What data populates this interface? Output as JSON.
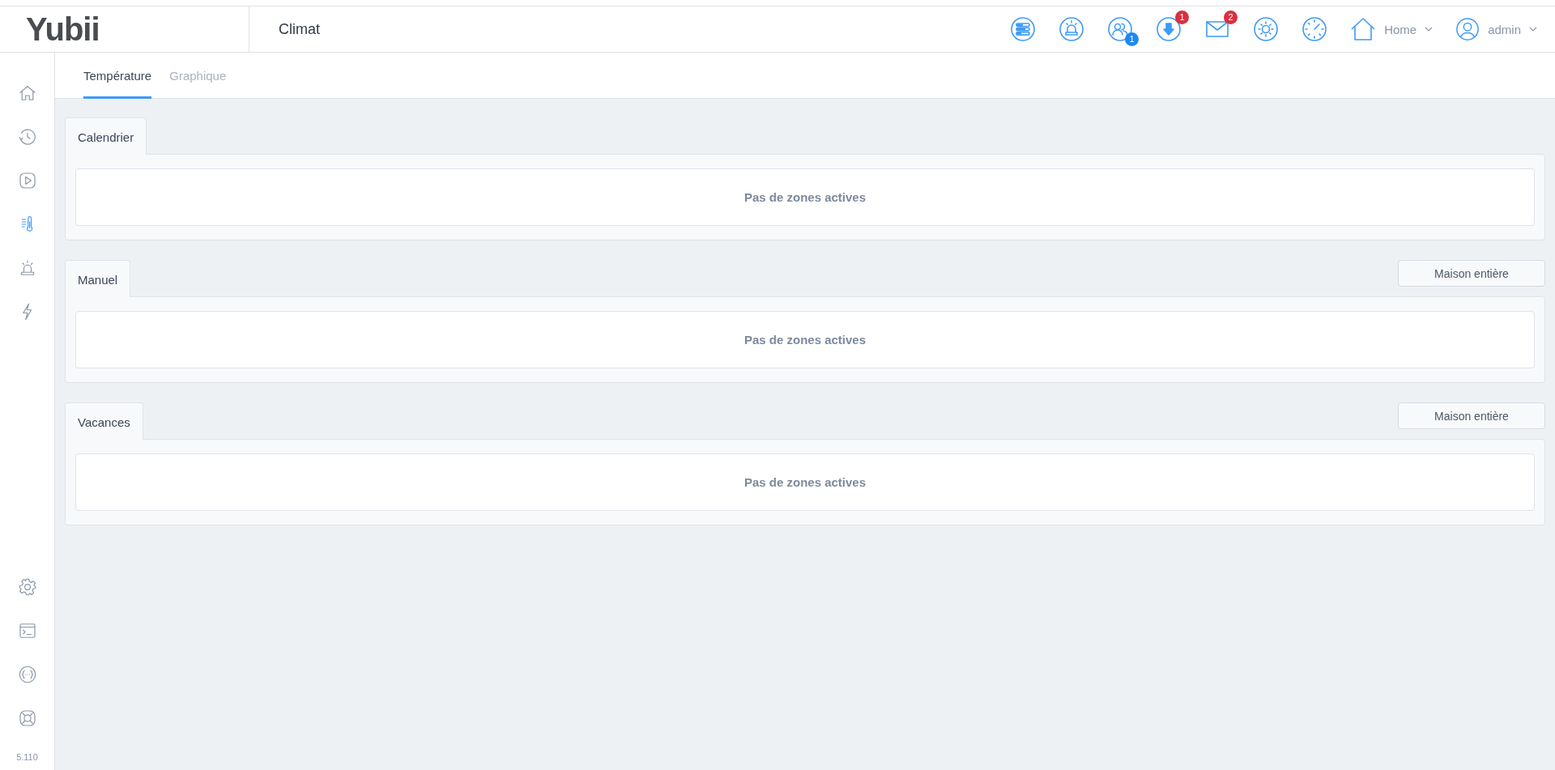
{
  "header": {
    "logo": "Yubii",
    "title": "Climat",
    "icons": [
      {
        "kind": "scenes"
      },
      {
        "kind": "alarm"
      },
      {
        "kind": "users",
        "badge": "1",
        "color": "#1e88f0"
      },
      {
        "kind": "download",
        "badge": "1",
        "color": "#d8303f"
      },
      {
        "kind": "mail",
        "badge": "2",
        "color": "#d8303f"
      },
      {
        "kind": "weather"
      },
      {
        "kind": "gauge"
      }
    ],
    "location": "Home",
    "user": "admin"
  },
  "sidebar": {
    "items": [
      {
        "kind": "home",
        "selected": false
      },
      {
        "kind": "history",
        "selected": false
      },
      {
        "kind": "play",
        "selected": false
      },
      {
        "kind": "thermometer",
        "selected": true
      },
      {
        "kind": "alarm",
        "selected": false
      },
      {
        "kind": "energy",
        "selected": false
      }
    ],
    "bottom_items": [
      {
        "kind": "settings"
      },
      {
        "kind": "terminal"
      },
      {
        "kind": "api"
      },
      {
        "kind": "help"
      }
    ],
    "version": "5.110"
  },
  "tabs": [
    {
      "label": "Température",
      "selected": true
    },
    {
      "label": "Graphique",
      "selected": false
    }
  ],
  "sections": [
    {
      "title": "Calendrier",
      "message": "Pas de zones actives"
    },
    {
      "title": "Manuel",
      "button": "Maison entière",
      "message": "Pas de zones actives"
    },
    {
      "title": "Vacances",
      "button": "Maison entière",
      "message": "Pas de zones actives"
    }
  ]
}
